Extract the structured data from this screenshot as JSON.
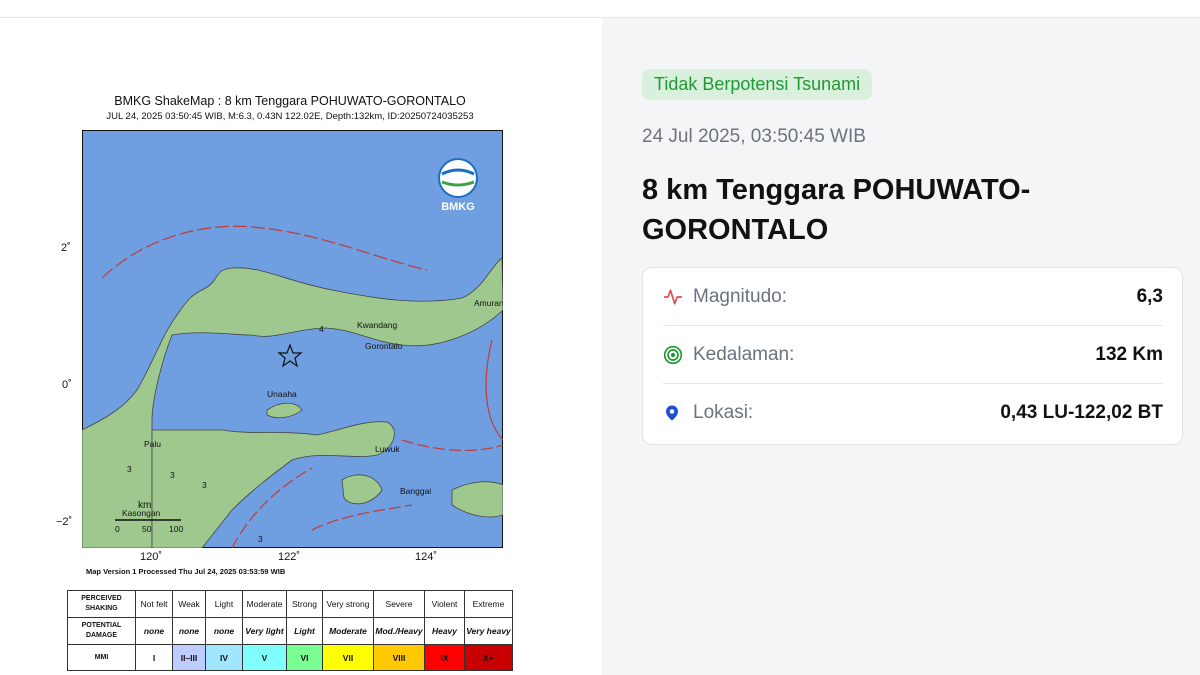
{
  "shakemap": {
    "title": "BMKG ShakeMap : 8 km Tenggara POHUWATO-GORONTALO",
    "subtitle": "JUL 24, 2025 03:50:45 WIB, M:6.3, 0.43N 122.02E, Depth:132km, ID:20250724035253",
    "logo_text": "BMKG",
    "y_ticks": [
      "2˚",
      "0˚",
      "−2˚"
    ],
    "x_ticks": [
      "120˚",
      "122˚",
      "124˚"
    ],
    "places": [
      "Kwandang",
      "Gorontalo",
      "Unaaha",
      "Palu",
      "Luwuk",
      "Banggai",
      "Kasongan",
      "Amurang"
    ],
    "intensity_labels": [
      "4",
      "3",
      "3",
      "3",
      "3"
    ],
    "scale_label": "km",
    "scale_ticks": [
      "0",
      "50",
      "100"
    ],
    "process_line": "Map Version 1 Processed Thu Jul 24, 2025 03:53:59 WIB",
    "table": {
      "headers": [
        "PERCEIVED SHAKING",
        "Not felt",
        "Weak",
        "Light",
        "Moderate",
        "Strong",
        "Very strong",
        "Severe",
        "Violent",
        "Extreme"
      ],
      "damage": [
        "POTENTIAL DAMAGE",
        "none",
        "none",
        "none",
        "Very light",
        "Light",
        "Moderate",
        "Mod./Heavy",
        "Heavy",
        "Very heavy"
      ],
      "mmi": [
        "MMI",
        "I",
        "II–III",
        "IV",
        "V",
        "VI",
        "VII",
        "VIII",
        "IX",
        "X+"
      ],
      "colors": [
        "#ffffff",
        "#bfccff",
        "#a0e6ff",
        "#80ffff",
        "#7aff93",
        "#ffff00",
        "#ffc800",
        "#ff9100",
        "#ff0000",
        "#c80000"
      ]
    }
  },
  "info": {
    "badge": "Tidak Berpotensi Tsunami",
    "datetime": "24 Jul 2025, 03:50:45 WIB",
    "title": "8 km Tenggara POHUWATO-GORONTALO",
    "rows": [
      {
        "label": "Magnitudo:",
        "value": "6,3",
        "icon": "activity-icon"
      },
      {
        "label": "Kedalaman:",
        "value": "132 Km",
        "icon": "target-icon"
      },
      {
        "label": "Lokasi:",
        "value": "0,43 LU-122,02 BT",
        "icon": "location-pin-icon"
      }
    ],
    "accent_colors": {
      "badge_bg": "#d9f0dc",
      "badge_text": "#1f9a33",
      "magnitude_icon": "#e24b4b",
      "depth_icon": "#1f9a33",
      "location_icon": "#1f4fd1"
    }
  }
}
